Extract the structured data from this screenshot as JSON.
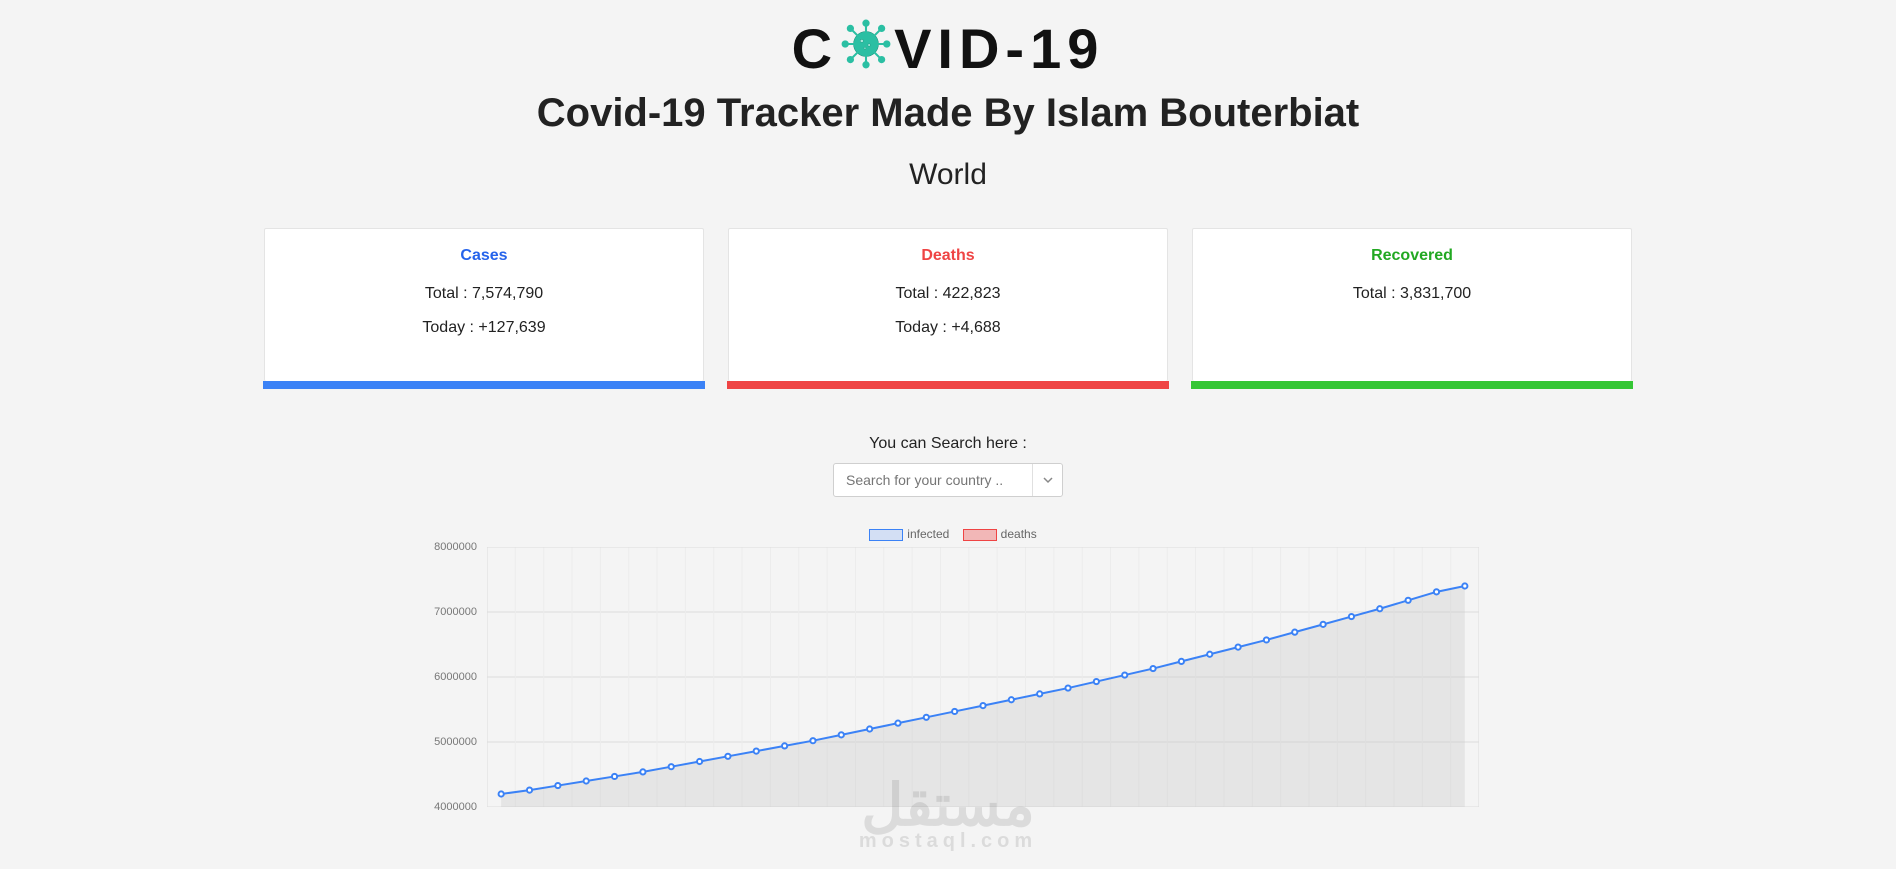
{
  "logo": {
    "left": "C",
    "right": "VID-19"
  },
  "title": "Covid-19 Tracker Made By Islam Bouterbiat",
  "subtitle": "World",
  "cards": {
    "cases": {
      "label": "Cases",
      "total": "Total : 7,574,790",
      "today": "Today : +127,639"
    },
    "deaths": {
      "label": "Deaths",
      "total": "Total : 422,823",
      "today": "Today : +4,688"
    },
    "recovered": {
      "label": "Recovered",
      "total": "Total : 3,831,700"
    }
  },
  "search": {
    "label": "You can Search here :",
    "placeholder": "Search for your country .."
  },
  "legend": {
    "infected": "infected",
    "deaths": "deaths"
  },
  "watermark": {
    "ar": "مستقل",
    "lat": "mostaql.com"
  },
  "chart_data": {
    "type": "line",
    "title": "",
    "xlabel": "",
    "ylabel": "",
    "ylim": [
      4000000,
      8000000
    ],
    "y_ticks": [
      8000000,
      7000000,
      6000000,
      5000000,
      4000000
    ],
    "series": [
      {
        "name": "infected",
        "color": "#3b82f6",
        "values": [
          4200000,
          4260000,
          4330000,
          4400000,
          4470000,
          4540000,
          4620000,
          4700000,
          4780000,
          4860000,
          4940000,
          5020000,
          5110000,
          5200000,
          5290000,
          5380000,
          5470000,
          5560000,
          5650000,
          5740000,
          5830000,
          5930000,
          6030000,
          6130000,
          6240000,
          6350000,
          6460000,
          6570000,
          6690000,
          6810000,
          6930000,
          7050000,
          7180000,
          7310000,
          7400000
        ]
      },
      {
        "name": "deaths",
        "color": "#ef4444",
        "values": []
      }
    ]
  }
}
